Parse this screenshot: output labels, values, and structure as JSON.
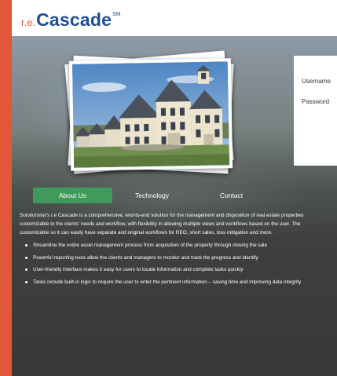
{
  "header": {
    "logo_prefix": "r.e.",
    "logo_main": "Cascade",
    "logo_mark": "SM"
  },
  "login": {
    "username_label": "Username",
    "password_label": "Password"
  },
  "tabs": [
    {
      "label": "About Us",
      "active": true
    },
    {
      "label": "Technology",
      "active": false
    },
    {
      "label": "Contact",
      "active": false
    }
  ],
  "about": {
    "lines": [
      "Solutionstar's r.e Cascade is a comprehensive, end-to-end solution for the management and disposition of real estate properties",
      "customizable to the clients' needs and workflow, with flexibility in allowing multiple views and workflows based on the user. The",
      "customizable so it can easily have separate and original workflows for REO, short sales, loss mitigation and more."
    ],
    "bullets": [
      "Streamline the entire asset management process from acquisition of the property through closing the sale",
      "Powerful reporting tools allow the clients and managers to monitor and track the progress and identify",
      "User-friendly interface makes it easy for users to locate information and complete tasks quickly",
      "Tasks include built-in logic to require the user to enter the pertinent information – saving time and improving data integrity"
    ]
  },
  "colors": {
    "accent_red": "#e2573a",
    "logo_blue": "#1f4e92",
    "tab_active": "#3f9a5c"
  }
}
